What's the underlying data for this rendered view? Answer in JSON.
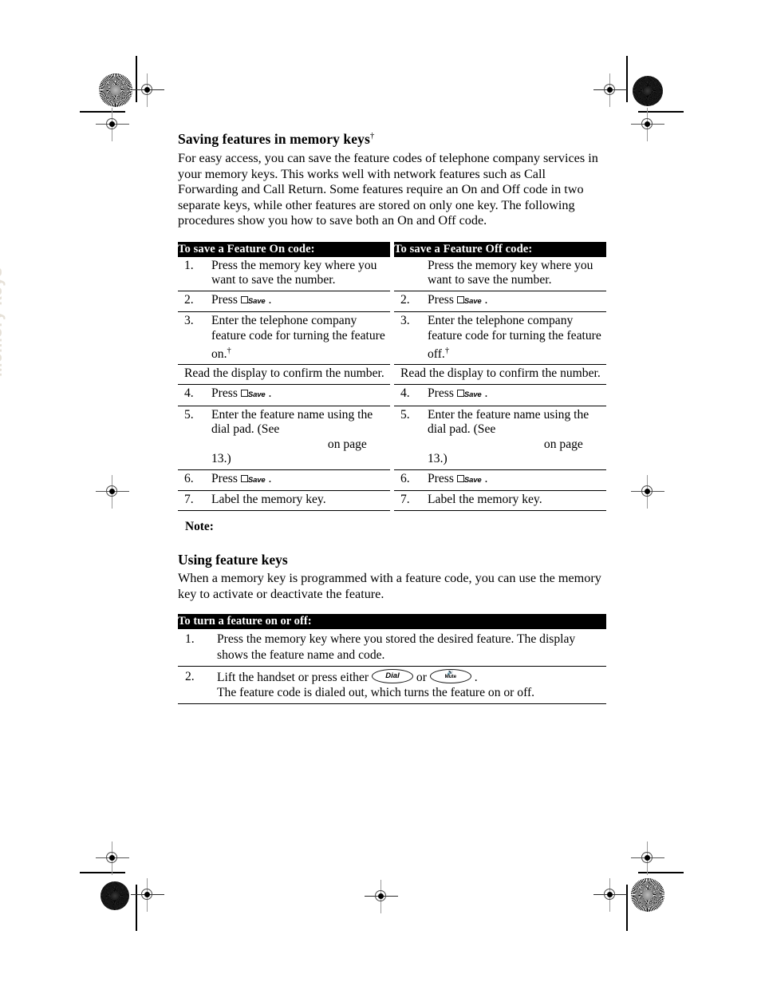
{
  "side_tab": {
    "label": "Memory keys"
  },
  "section_1": {
    "heading": "Saving features in memory keys",
    "heading_footnote": "†",
    "body": "For easy access, you can save the feature codes of telephone company services in your memory keys. This works well with network features such as Call Forwarding and Call Return. Some features require an On and Off code in two separate keys, while other features are stored on only one key. The following procedures show you how to save both an On and Off code."
  },
  "table_on": {
    "header": "To save a Feature On code:",
    "rows": [
      {
        "num": "1.",
        "text": "Press the memory key where you want to save the number."
      },
      {
        "num": "2.",
        "text_before": "Press ",
        "key": "Save",
        "text_after": " ."
      },
      {
        "num": "3.",
        "text": "Enter the telephone company feature code for turning the feature on.",
        "footnote": "†"
      },
      {
        "num": "",
        "text": "Read the display to confirm the number.",
        "full_width": true
      },
      {
        "num": "4.",
        "text_before": "Press ",
        "key": "Save",
        "text_after": " ."
      },
      {
        "num": "5.",
        "text_before": "Enter the feature name using the dial pad. (See ",
        "text_after": " on page 13.)"
      },
      {
        "num": "6.",
        "text_before": "Press ",
        "key": "Save",
        "text_after": " ."
      },
      {
        "num": "7.",
        "text": "Label the memory key."
      }
    ]
  },
  "table_off": {
    "header": "To save a Feature Off code:",
    "rows": [
      {
        "num": "",
        "text": "Press the memory key where you want to save the number."
      },
      {
        "num": "2.",
        "text_before": "Press ",
        "key": "Save",
        "text_after": " ."
      },
      {
        "num": "3.",
        "text": "Enter the telephone company feature code for turning the feature off.",
        "footnote": "†"
      },
      {
        "num": "",
        "text": "Read the display to confirm the number.",
        "full_width": true
      },
      {
        "num": "4.",
        "text_before": "Press ",
        "key": "Save",
        "text_after": " ."
      },
      {
        "num": "5.",
        "text_before": "Enter the feature name using the dial pad. (See ",
        "text_after": " on page 13.)"
      },
      {
        "num": "6.",
        "text_before": "Press ",
        "key": "Save",
        "text_after": " ."
      },
      {
        "num": "7.",
        "text": "Label the memory key."
      }
    ]
  },
  "note": {
    "label": "Note:",
    "text": ""
  },
  "section_2": {
    "heading": "Using feature keys",
    "body": "When a memory key is programmed with a feature code, you can use the memory key to activate or deactivate the feature."
  },
  "table_toggle": {
    "header": "To turn a feature on or off:",
    "rows": [
      {
        "num": "1.",
        "text": "Press the memory key where you stored the desired feature. The display shows the feature name and code."
      },
      {
        "num": "2.",
        "text_before": "Lift the handset or press either ",
        "key_1": "Dial",
        "text_middle": " or ",
        "key_2": "Mute",
        "text_after": " .",
        "text_line2": "The feature code is dialed out, which turns the feature on or off."
      }
    ]
  },
  "colors": {
    "header_bar": "#000000",
    "header_text": "#ffffff",
    "body_text": "#000000",
    "side_tab_text": "#e6e1d8"
  }
}
